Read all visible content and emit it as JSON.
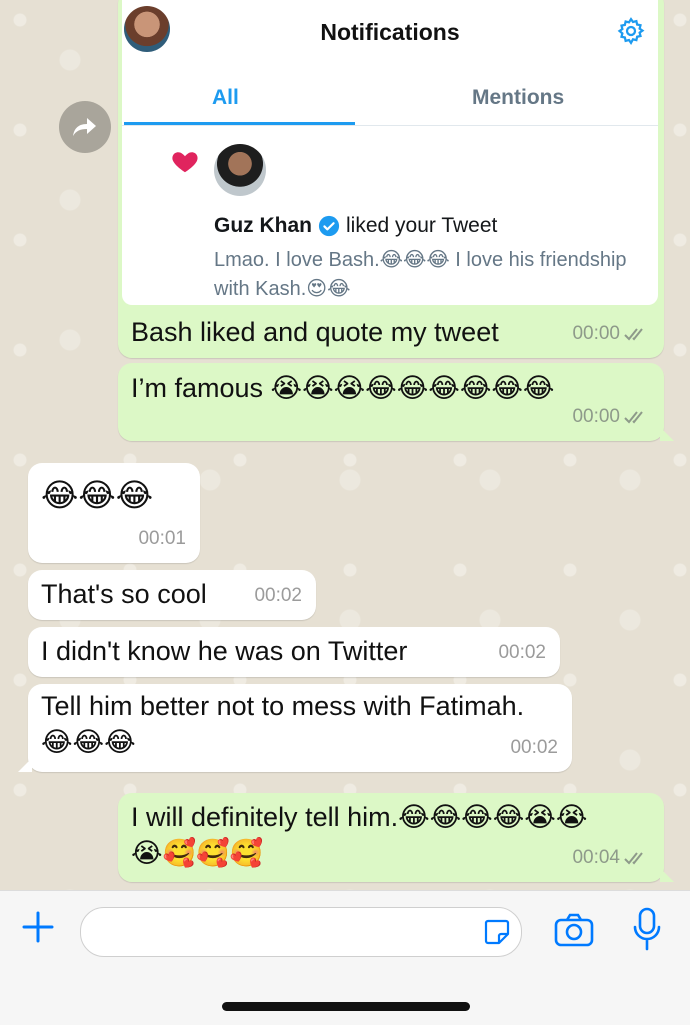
{
  "notification_card": {
    "title": "Notifications",
    "tabs": {
      "all": "All",
      "mentions": "Mentions"
    },
    "notification": {
      "name": "Guz Khan",
      "action": "liked your Tweet",
      "tweet_text": "Lmao. I love Bash.😂😂😂 I love his friendship with Kash.😍😂"
    }
  },
  "messages": [
    {
      "direction": "out",
      "text": "Bash liked and quote my tweet",
      "time": "00:00"
    },
    {
      "direction": "out",
      "text": "I’m famous 😭😭😭😂😂😂😂😂😂",
      "time": "00:00"
    },
    {
      "direction": "in",
      "text": "😂😂😂",
      "time": "00:01"
    },
    {
      "direction": "in",
      "text": "That's so cool",
      "time": "00:02"
    },
    {
      "direction": "in",
      "text": "I didn't know he was on Twitter",
      "time": "00:02"
    },
    {
      "direction": "in",
      "text": "Tell him better not to mess with Fatimah.\n😂😂😂",
      "time": "00:02"
    },
    {
      "direction": "out",
      "text": "I will definitely tell him.😂😂😂😂😭😭\n😭🥰🥰🥰",
      "time": "00:04"
    }
  ],
  "composer": {
    "placeholder": ""
  },
  "colors": {
    "outgoing": "#dcf8c6",
    "incoming": "#ffffff",
    "accent": "#1d9bf0",
    "ios_blue": "#007aff"
  },
  "icons": [
    "forward-icon",
    "gear-icon",
    "heart-icon",
    "verified-icon",
    "plus-icon",
    "sticker-icon",
    "camera-icon",
    "microphone-icon",
    "double-check-icon"
  ]
}
